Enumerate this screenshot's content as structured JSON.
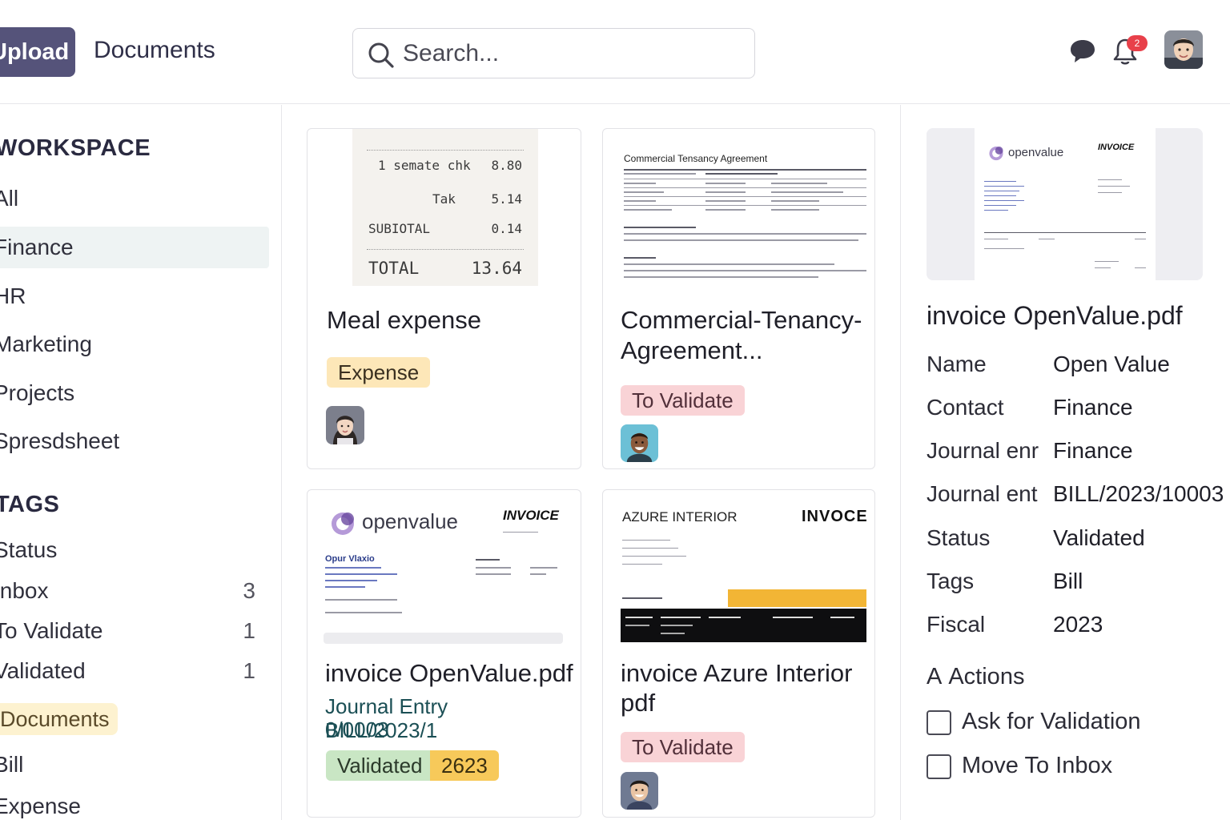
{
  "header": {
    "upload_label": "Upload",
    "app_title": "Documents",
    "search_placeholder": "Search...",
    "notification_count": "2"
  },
  "sidebar": {
    "workspace_title": "WORKSPACE",
    "workspace_items": [
      "All",
      "Finance",
      "HR",
      "Marketing",
      "Projects",
      "Spresdsheet"
    ],
    "active_item": "Finance",
    "tags_title": "TAGS",
    "status_group": "Status",
    "status_items": [
      {
        "label": "Inbox",
        "count": "3"
      },
      {
        "label": "To Validate",
        "count": "1"
      },
      {
        "label": "Validated",
        "count": "1"
      }
    ],
    "documents_chip": "Documents",
    "document_tags": [
      "Bill",
      "Expense"
    ]
  },
  "cards": [
    {
      "title": "Meal expense",
      "tag": "Expense",
      "receipt": {
        "rows": [
          {
            "label": "1 semate chk",
            "amount": "8.80"
          },
          {
            "label": "Tak",
            "amount": "5.14"
          },
          {
            "label": "SUBIOTAL",
            "amount": "0.14"
          }
        ],
        "total_label": "TOTAL",
        "total_amount": "13.64"
      }
    },
    {
      "title_line1": "Commercial-Tenancy-",
      "title_line2": "Agreement...",
      "tag": "To Validate",
      "preview_heading": "Commercial Tensancy Agreement"
    },
    {
      "title": "invoice OpenValue.pdf",
      "journal_line1": "Journal Entry BILL/2023/1",
      "journal_line2": "0/0003",
      "tag": "Validated",
      "year": "2623",
      "preview_brand": "openvalue",
      "preview_doc_type": "INVOICE",
      "preview_customer": "Opur Vlaxio"
    },
    {
      "title_line1": "invoice Azure Interior",
      "title_line2": "pdf",
      "tag": "To Validate",
      "preview_company": "AZURE INTERIOR",
      "preview_doc_type": "INVOCE"
    }
  ],
  "detail": {
    "thumb_brand": "openvalue",
    "thumb_doc_type": "INVOICE",
    "title": "invoice OpenValue.pdf",
    "fields": [
      {
        "label": "Name",
        "value": "Open Value"
      },
      {
        "label": "Contact",
        "value": "Finance"
      },
      {
        "label": "Journal enr",
        "value": "Finance"
      },
      {
        "label": "Journal ent",
        "value": "BILL/2023/10003"
      },
      {
        "label": "Status",
        "value": "Validated"
      },
      {
        "label": "Tags",
        "value": "Bill"
      },
      {
        "label": "Fiscal",
        "value": "2023"
      }
    ],
    "actions_title": "Actions",
    "actions_icon": "A",
    "actions": [
      "Ask for Validation",
      "Move To Inbox"
    ]
  },
  "colors": {
    "upload_bg": "#55537a",
    "expense_tag": "#fde7b8",
    "to_validate_tag": "#f9d3d6",
    "validated_tag": "#c9e6c4",
    "year_tag": "#f7c95a",
    "documents_chip": "#fdf2d0",
    "notification_badge": "#e8404a"
  }
}
